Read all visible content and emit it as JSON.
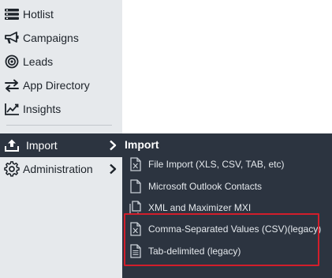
{
  "sidebar": {
    "items": [
      {
        "label": "Hotlist",
        "icon": "hotlist-icon"
      },
      {
        "label": "Campaigns",
        "icon": "megaphone-icon"
      },
      {
        "label": "Leads",
        "icon": "target-icon"
      },
      {
        "label": "App Directory",
        "icon": "exchange-arrows-icon"
      },
      {
        "label": "Insights",
        "icon": "line-chart-icon"
      },
      {
        "label": "Import",
        "icon": "upload-icon",
        "active": true
      },
      {
        "label": "Administration",
        "icon": "gear-icon"
      }
    ]
  },
  "flyout": {
    "title": "Import",
    "items": [
      {
        "label": "File Import (XLS, CSV, TAB, etc)",
        "icon": "excel-file-icon"
      },
      {
        "label": "Microsoft Outlook Contacts",
        "icon": "blank-file-icon"
      },
      {
        "label": "XML and Maximizer MXI",
        "icon": "files-icon"
      },
      {
        "label": "Comma-Separated Values (CSV)(legacy)",
        "icon": "excel-file-icon"
      },
      {
        "label": "Tab-delimited (legacy)",
        "icon": "text-file-icon"
      }
    ]
  },
  "colors": {
    "sidebar_bg": "#e6e9ec",
    "active_bg": "#2c3440",
    "highlight": "#d21e2b"
  }
}
